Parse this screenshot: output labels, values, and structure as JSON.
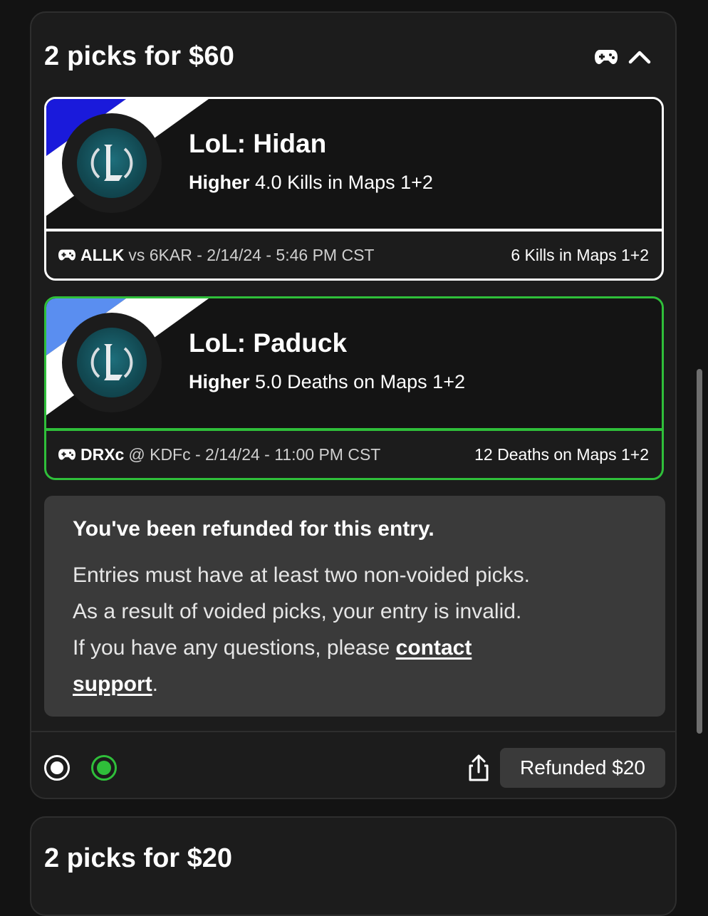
{
  "entry": {
    "title": "2 picks for $60",
    "header_icons": [
      "gamepad-icon",
      "chevron-up-icon"
    ]
  },
  "picks": [
    {
      "name": "LoL: Hidan",
      "direction": "Higher",
      "line_value": "4.0 Kills in Maps 1+2",
      "team": "ALLK",
      "matchup_rest": "vs 6KAR - 2/14/24 - 5:46 PM CST",
      "result": "6 Kills in Maps 1+2",
      "stripe_color": "#1a1adb",
      "border_color": "#ffffff"
    },
    {
      "name": "LoL: Paduck",
      "direction": "Higher",
      "line_value": "5.0 Deaths on Maps 1+2",
      "team": "DRXc",
      "matchup_rest": "@ KDFc - 2/14/24 - 11:00 PM CST",
      "result": "12 Deaths on Maps 1+2",
      "stripe_color": "#5a8ef0",
      "border_color": "#2fbf3a"
    }
  ],
  "notice": {
    "title": "You've been refunded for this entry.",
    "line1": "Entries must have at least two non-voided picks.",
    "line2": "As a result of voided picks, your entry is invalid.",
    "line3_prefix": "If you have any questions, please ",
    "link_part1": "contact",
    "link_part2": "support",
    "suffix": "."
  },
  "footer": {
    "refund_label": "Refunded $20"
  },
  "next_entry": {
    "title": "2 picks for $20"
  },
  "colors": {
    "accent_green": "#2fbf3a",
    "card_bg": "#1c1c1c",
    "notice_bg": "#3a3a3a"
  }
}
